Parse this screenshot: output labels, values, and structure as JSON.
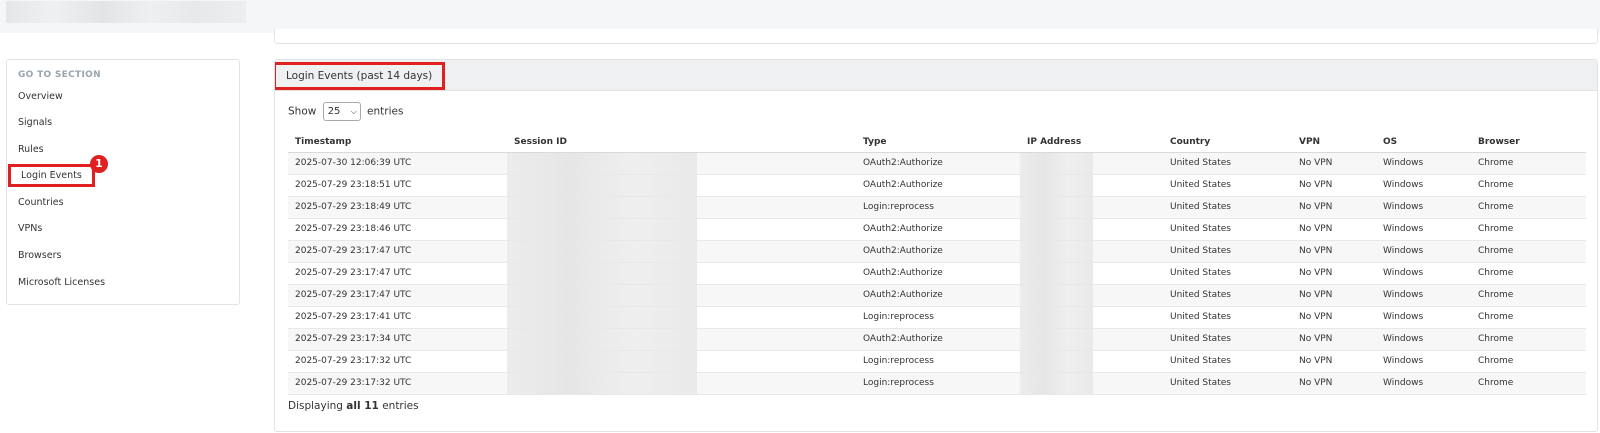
{
  "sidebar": {
    "heading": "GO TO SECTION",
    "items": [
      {
        "label": "Overview"
      },
      {
        "label": "Signals"
      },
      {
        "label": "Rules"
      },
      {
        "label": "Login Events",
        "active": true
      },
      {
        "label": "Countries"
      },
      {
        "label": "VPNs"
      },
      {
        "label": "Browsers"
      },
      {
        "label": "Microsoft Licenses"
      }
    ],
    "badge": "1"
  },
  "panel": {
    "title": "Login Events (past 14 days)",
    "show_label": "Show",
    "page_size": "25",
    "entries_label": "entries",
    "columns": [
      "Timestamp",
      "Session ID",
      "Type",
      "IP Address",
      "Country",
      "VPN",
      "OS",
      "Browser"
    ],
    "rows": [
      {
        "timestamp": "2025-07-30 12:06:39 UTC",
        "type": "OAuth2:Authorize",
        "country": "United States",
        "vpn": "No VPN",
        "os": "Windows",
        "browser": "Chrome"
      },
      {
        "timestamp": "2025-07-29 23:18:51 UTC",
        "type": "OAuth2:Authorize",
        "country": "United States",
        "vpn": "No VPN",
        "os": "Windows",
        "browser": "Chrome"
      },
      {
        "timestamp": "2025-07-29 23:18:49 UTC",
        "type": "Login:reprocess",
        "country": "United States",
        "vpn": "No VPN",
        "os": "Windows",
        "browser": "Chrome"
      },
      {
        "timestamp": "2025-07-29 23:18:46 UTC",
        "type": "OAuth2:Authorize",
        "country": "United States",
        "vpn": "No VPN",
        "os": "Windows",
        "browser": "Chrome"
      },
      {
        "timestamp": "2025-07-29 23:17:47 UTC",
        "type": "OAuth2:Authorize",
        "country": "United States",
        "vpn": "No VPN",
        "os": "Windows",
        "browser": "Chrome"
      },
      {
        "timestamp": "2025-07-29 23:17:47 UTC",
        "type": "OAuth2:Authorize",
        "country": "United States",
        "vpn": "No VPN",
        "os": "Windows",
        "browser": "Chrome"
      },
      {
        "timestamp": "2025-07-29 23:17:47 UTC",
        "type": "OAuth2:Authorize",
        "country": "United States",
        "vpn": "No VPN",
        "os": "Windows",
        "browser": "Chrome"
      },
      {
        "timestamp": "2025-07-29 23:17:41 UTC",
        "type": "Login:reprocess",
        "country": "United States",
        "vpn": "No VPN",
        "os": "Windows",
        "browser": "Chrome"
      },
      {
        "timestamp": "2025-07-29 23:17:34 UTC",
        "type": "OAuth2:Authorize",
        "country": "United States",
        "vpn": "No VPN",
        "os": "Windows",
        "browser": "Chrome"
      },
      {
        "timestamp": "2025-07-29 23:17:32 UTC",
        "type": "Login:reprocess",
        "country": "United States",
        "vpn": "No VPN",
        "os": "Windows",
        "browser": "Chrome"
      },
      {
        "timestamp": "2025-07-29 23:17:32 UTC",
        "type": "Login:reprocess",
        "country": "United States",
        "vpn": "No VPN",
        "os": "Windows",
        "browser": "Chrome"
      }
    ],
    "footer": {
      "prefix": "Displaying",
      "bold": "all 11",
      "suffix": "entries"
    }
  },
  "colors": {
    "highlight": "#e02020",
    "header_bg": "#eef0f1"
  }
}
